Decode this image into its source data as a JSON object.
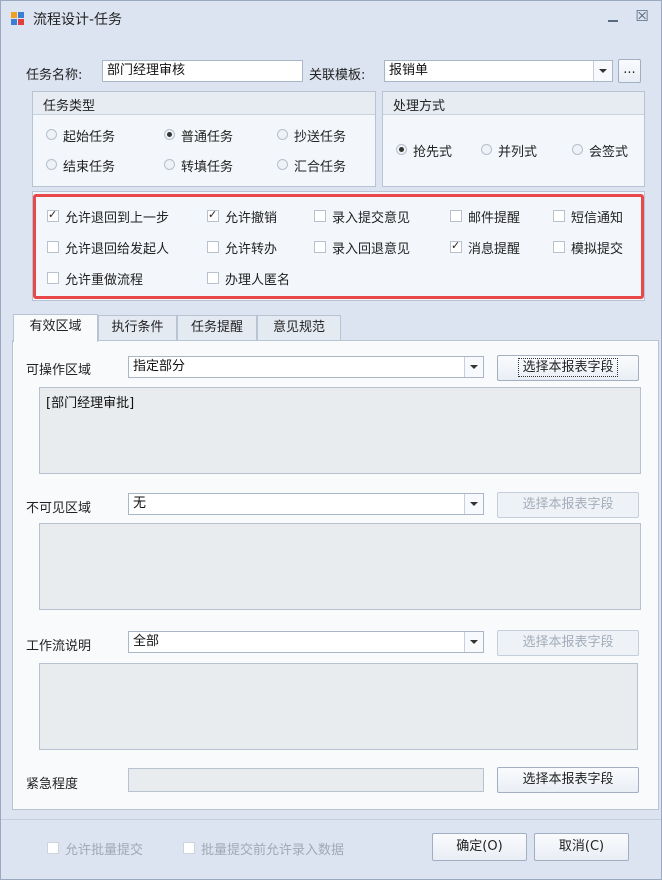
{
  "window": {
    "title": "流程设计-任务",
    "min_icon": "minimize-icon",
    "close_icon": "close-icon",
    "close_glyph": "☒"
  },
  "header": {
    "task_name_label": "任务名称:",
    "task_name_value": "部门经理审核",
    "template_label": "关联模板:",
    "template_value": "报销单",
    "browse_label": "..."
  },
  "task_type": {
    "title": "任务类型",
    "options": [
      {
        "label": "起始任务",
        "checked": false
      },
      {
        "label": "普通任务",
        "checked": true
      },
      {
        "label": "抄送任务",
        "checked": false
      },
      {
        "label": "结束任务",
        "checked": false
      },
      {
        "label": "转填任务",
        "checked": false
      },
      {
        "label": "汇合任务",
        "checked": false
      }
    ]
  },
  "process_mode": {
    "title": "处理方式",
    "options": [
      {
        "label": "抢先式",
        "checked": true
      },
      {
        "label": "并列式",
        "checked": false
      },
      {
        "label": "会签式",
        "checked": false
      }
    ]
  },
  "options": {
    "items": [
      {
        "label": "允许退回到上一步",
        "checked": true
      },
      {
        "label": "允许撤销",
        "checked": true
      },
      {
        "label": "录入提交意见",
        "checked": false
      },
      {
        "label": "邮件提醒",
        "checked": false
      },
      {
        "label": "短信通知",
        "checked": false
      },
      {
        "label": "允许退回给发起人",
        "checked": false
      },
      {
        "label": "允许转办",
        "checked": false
      },
      {
        "label": "录入回退意见",
        "checked": false
      },
      {
        "label": "消息提醒",
        "checked": true
      },
      {
        "label": "模拟提交",
        "checked": false
      },
      {
        "label": "允许重做流程",
        "checked": false
      },
      {
        "label": "办理人匿名",
        "checked": false
      }
    ],
    "highlight_color": "#e8484a"
  },
  "tabs": [
    {
      "label": "有效区域",
      "active": true
    },
    {
      "label": "执行条件",
      "active": false
    },
    {
      "label": "任务提醒",
      "active": false
    },
    {
      "label": "意见规范",
      "active": false
    }
  ],
  "panel": {
    "operable": {
      "label": "可操作区域",
      "value": "指定部分",
      "button": "选择本报表字段",
      "content": "[部门经理审批]"
    },
    "invisible": {
      "label": "不可见区域",
      "value": "无",
      "button": "选择本报表字段",
      "content": ""
    },
    "workflow_desc": {
      "label": "工作流说明",
      "value": "全部",
      "button": "选择本报表字段",
      "content": ""
    },
    "urgency": {
      "label": "紧急程度",
      "button": "选择本报表字段"
    }
  },
  "footer": {
    "batch_submit": "允许批量提交",
    "batch_input": "批量提交前允许录入数据",
    "ok": "确定(O)",
    "cancel": "取消(C)"
  }
}
